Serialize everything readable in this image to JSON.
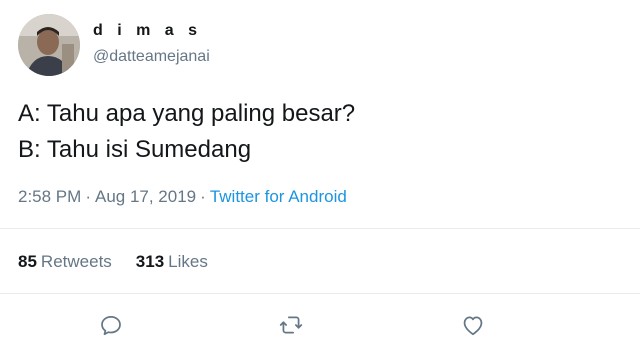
{
  "user": {
    "display_name": "d i m a s",
    "handle": "@datteamejanai"
  },
  "tweet": {
    "lines": [
      "A: Tahu apa yang paling besar?",
      "B: Tahu isi Sumedang"
    ],
    "time": "2:58 PM",
    "date": "Aug 17, 2019",
    "separator": "·",
    "source": "Twitter for Android"
  },
  "stats": {
    "retweets_count": "85",
    "retweets_label": "Retweets",
    "likes_count": "313",
    "likes_label": "Likes"
  },
  "actions": {
    "reply_icon": "reply-icon",
    "retweet_icon": "retweet-icon",
    "like_icon": "heart-icon"
  },
  "colors": {
    "text": "#14171a",
    "secondary": "#657786",
    "link": "#1b95e0",
    "divider": "#e6ecf0"
  }
}
